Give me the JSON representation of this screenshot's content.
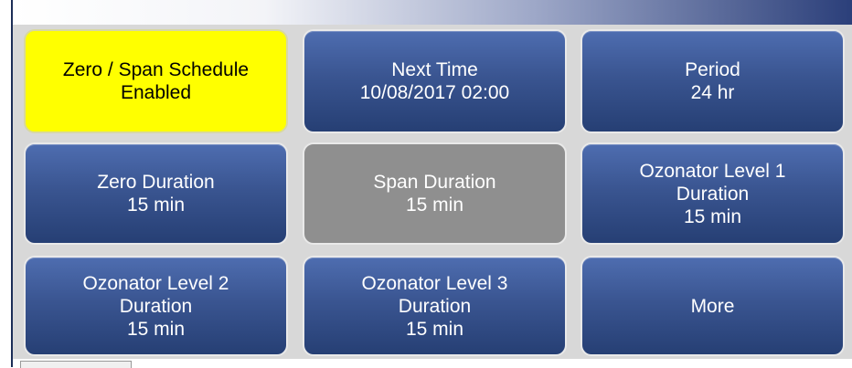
{
  "colors": {
    "panel_bg": "#d8d8d8",
    "tile_blue": "#3a5591",
    "tile_selected": "#ffff00",
    "tile_disabled": "#8f8f8f"
  },
  "tiles": [
    {
      "lines": [
        "Zero / Span Schedule",
        "Enabled"
      ],
      "state": "selected"
    },
    {
      "lines": [
        "Next Time",
        "10/08/2017 02:00"
      ],
      "state": "normal"
    },
    {
      "lines": [
        "Period",
        "24 hr"
      ],
      "state": "normal"
    },
    {
      "lines": [
        "Zero Duration",
        "15 min"
      ],
      "state": "normal"
    },
    {
      "lines": [
        "Span Duration",
        "15 min"
      ],
      "state": "disabled"
    },
    {
      "lines": [
        "Ozonator Level 1",
        "Duration",
        "15 min"
      ],
      "state": "normal"
    },
    {
      "lines": [
        "Ozonator Level 2",
        "Duration",
        "15 min"
      ],
      "state": "normal"
    },
    {
      "lines": [
        "Ozonator Level 3",
        "Duration",
        "15 min"
      ],
      "state": "normal"
    },
    {
      "lines": [
        "More"
      ],
      "state": "normal"
    }
  ]
}
